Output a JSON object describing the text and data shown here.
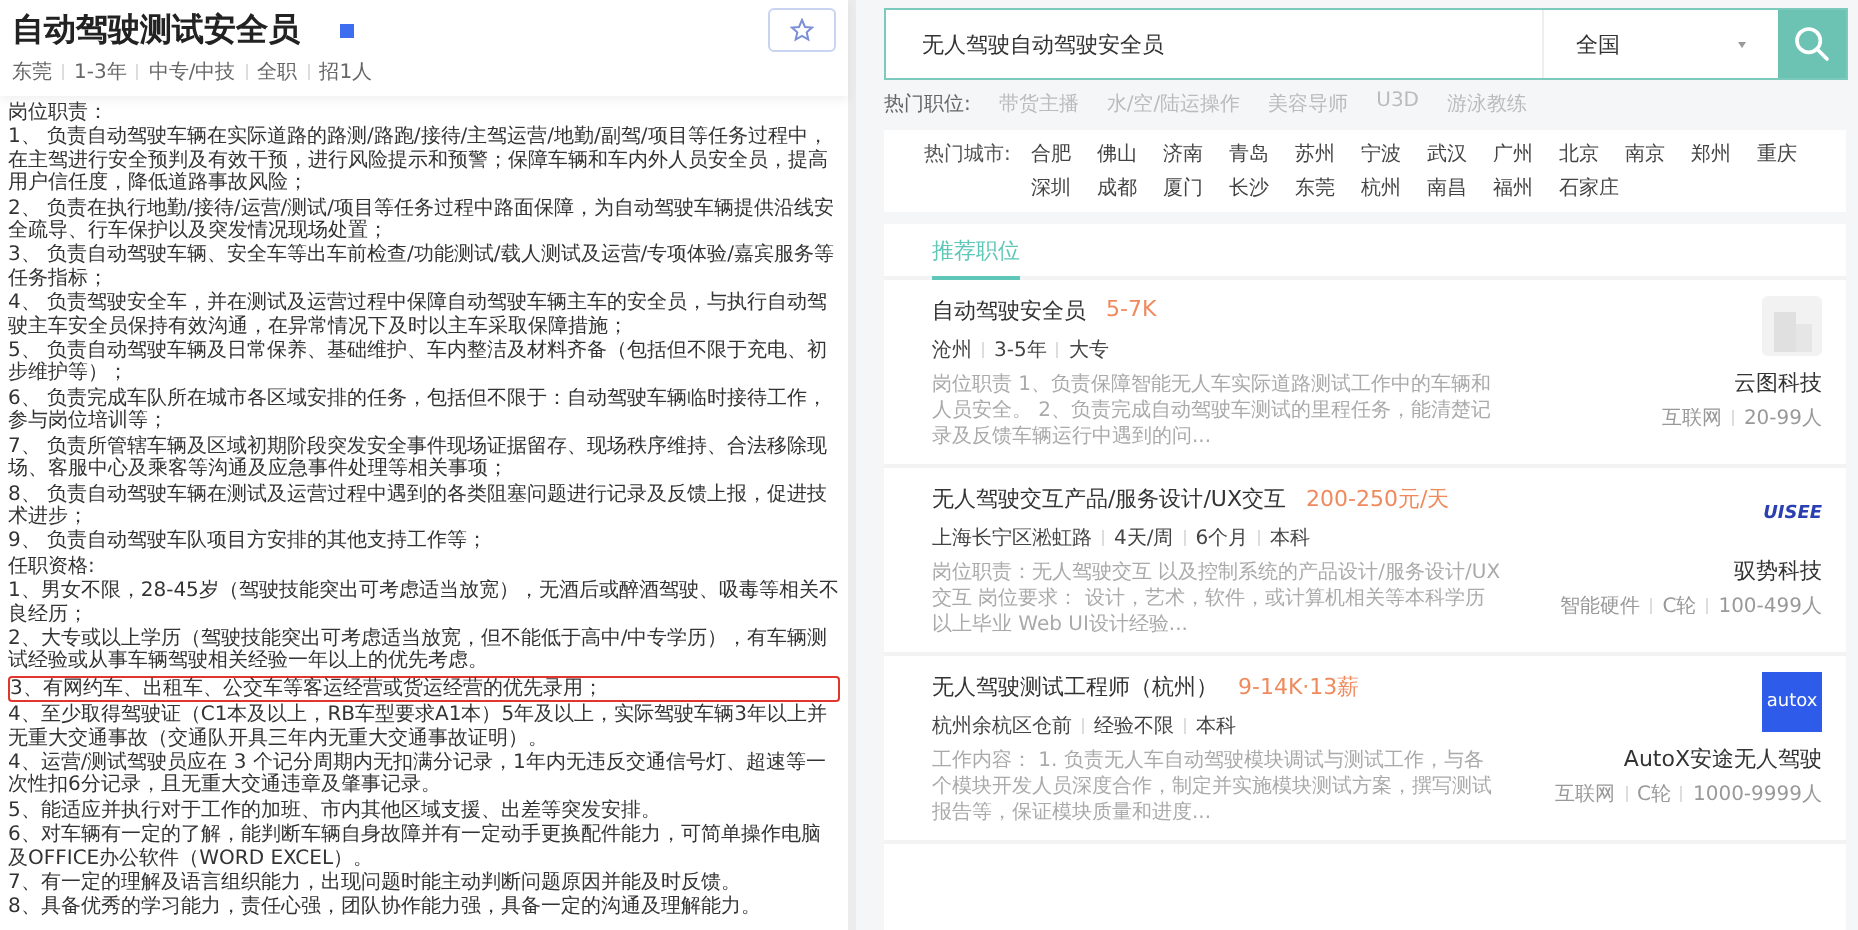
{
  "job_detail": {
    "title": "自动驾驶测试安全员",
    "meta": [
      "东莞",
      "1-3年",
      "中专/中技",
      "全职",
      "招1人"
    ],
    "sections": [
      {
        "heading": "岗位职责：",
        "items": [
          {
            "text": "1、 负责自动驾驶车辆在实际道路的路测/路跑/接待/主驾运营/地勤/副驾/项目等任务过程中，在主驾进行安全预判及有效干预，进行风险提示和预警；保障车辆和车内外人员安全员，提高用户信任度，降低道路事故风险；",
            "highlighted": false
          },
          {
            "text": "2、 负责在执行地勤/接待/运营/测试/项目等任务过程中路面保障，为自动驾驶车辆提供沿线安全疏导、行车保护以及突发情况现场处置；",
            "highlighted": false
          },
          {
            "text": "3、 负责自动驾驶车辆、安全车等出车前检查/功能测试/载人测试及运营/专项体验/嘉宾服务等任务指标；",
            "highlighted": false
          },
          {
            "text": "4、 负责驾驶安全车，并在测试及运营过程中保障自动驾驶车辆主车的安全员，与执行自动驾驶主车安全员保持有效沟通，在异常情况下及时以主车采取保障措施；",
            "highlighted": false
          },
          {
            "text": "5、 负责自动驾驶车辆及日常保养、基础维护、车内整洁及材料齐备（包括但不限于充电、初步维护等）；",
            "highlighted": false
          },
          {
            "text": "6、 负责完成车队所在城市各区域安排的任务，包括但不限于：自动驾驶车辆临时接待工作，参与岗位培训等；",
            "highlighted": false
          },
          {
            "text": "7、 负责所管辖车辆及区域初期阶段突发安全事件现场证据留存、现场秩序维持、合法移除现场、客服中心及乘客等沟通及应急事件处理等相关事项；",
            "highlighted": false
          },
          {
            "text": "8、 负责自动驾驶车辆在测试及运营过程中遇到的各类阻塞问题进行记录及反馈上报，促进技术进步；",
            "highlighted": false
          },
          {
            "text": "9、 负责自动驾驶车队项目方安排的其他支持工作等；",
            "highlighted": false
          }
        ]
      },
      {
        "heading": "任职资格:",
        "items": [
          {
            "text": "1、男女不限，28-45岁（驾驶技能突出可考虑适当放宽），无酒后或醉酒驾驶、吸毒等相关不良经历；",
            "highlighted": false
          },
          {
            "text": "2、大专或以上学历（驾驶技能突出可考虑适当放宽，但不能低于高中/中专学历），有车辆测试经验或从事车辆驾驶相关经验一年以上的优先考虑。",
            "highlighted": false
          },
          {
            "text": "3、有网约车、出租车、公交车等客运经营或货运经营的优先录用；",
            "highlighted": true
          },
          {
            "text": "4、至少取得驾驶证（C1本及以上，RB车型要求A1本）5年及以上，实际驾驶车辆3年以上并无重大交通事故（交通队开具三年内无重大交通事故证明）。",
            "highlighted": false
          },
          {
            "text": "4、运营/测试驾驶员应在 3 个记分周期内无扣满分记录，1年内无违反交通信号灯、超速等一次性扣6分记录，且无重大交通违章及肇事记录。",
            "highlighted": false
          },
          {
            "text": "5、能适应并执行对于工作的加班、市内其他区域支援、出差等突发安排。",
            "highlighted": false
          },
          {
            "text": "6、对车辆有一定的了解，能判断车辆自身故障并有一定动手更换配件能力，可简单操作电脑及OFFICE办公软件（WORD EXCEL）。",
            "highlighted": false
          },
          {
            "text": "7、有一定的理解及语言组织能力，出现问题时能主动判断问题原因并能及时反馈。",
            "highlighted": false
          },
          {
            "text": "8、具备优秀的学习能力，责任心强，团队协作能力强，具备一定的沟通及理解能力。",
            "highlighted": false
          }
        ]
      }
    ]
  },
  "search": {
    "value": "无人驾驶自动驾驶安全员",
    "city": "全国"
  },
  "hot_jobs": {
    "label": "热门职位:",
    "items": [
      "带货主播",
      "水/空/陆运操作",
      "美容导师",
      "U3D",
      "游泳教练"
    ]
  },
  "hot_cities": {
    "label": "热门城市:",
    "items": [
      "合肥",
      "佛山",
      "济南",
      "青岛",
      "苏州",
      "宁波",
      "武汉",
      "广州",
      "北京",
      "南京",
      "郑州",
      "重庆",
      "深圳",
      "成都",
      "厦门",
      "长沙",
      "东莞",
      "杭州",
      "南昌",
      "福州",
      "石家庄"
    ]
  },
  "tabs": [
    {
      "label": "推荐职位",
      "selected": true
    }
  ],
  "jobs": [
    {
      "title": "自动驾驶安全员",
      "salary": "5-7K",
      "tags": [
        "沧州",
        "3-5年",
        "大专"
      ],
      "description": "岗位职责 1、负责保障智能无人车实际道路测试工作中的车辆和人员安全。 2、负责完成自动驾驶车测试的里程任务，能清楚记录及反馈车辆运行中遇到的问...",
      "logo": {
        "kind": "building"
      },
      "company": "云图科技",
      "company_tags": [
        "互联网",
        "20-99人"
      ]
    },
    {
      "title": "无人驾驶交互产品/服务设计/UX交互",
      "salary": "200-250元/天",
      "tags": [
        "上海长宁区淞虹路",
        "4天/周",
        "6个月",
        "本科"
      ],
      "description": "岗位职责：无人驾驶交互 以及控制系统的产品设计/服务设计/UX交互 岗位要求： 设计，艺术，软件，或计算机相关等本科学历以上毕业 Web UI设计经验...",
      "logo": {
        "kind": "wordmark",
        "text": "UISEE"
      },
      "company": "驭势科技",
      "company_tags": [
        "智能硬件",
        "C轮",
        "100-499人"
      ]
    },
    {
      "title": "无人驾驶测试工程师（杭州）",
      "salary": "9-14K·13薪",
      "tags": [
        "杭州余杭区仓前",
        "经验不限",
        "本科"
      ],
      "description": "工作内容： 1. 负责无人车自动驾驶模块调试与测试工作，与各个模块开发人员深度合作，制定并实施模块测试方案，撰写测试报告等，保证模块质量和进度...",
      "logo": {
        "kind": "tile",
        "text": "autox"
      },
      "company": "AutoX安途无人驾驶",
      "company_tags": [
        "互联网",
        "C轮",
        "1000-9999人"
      ]
    }
  ]
}
